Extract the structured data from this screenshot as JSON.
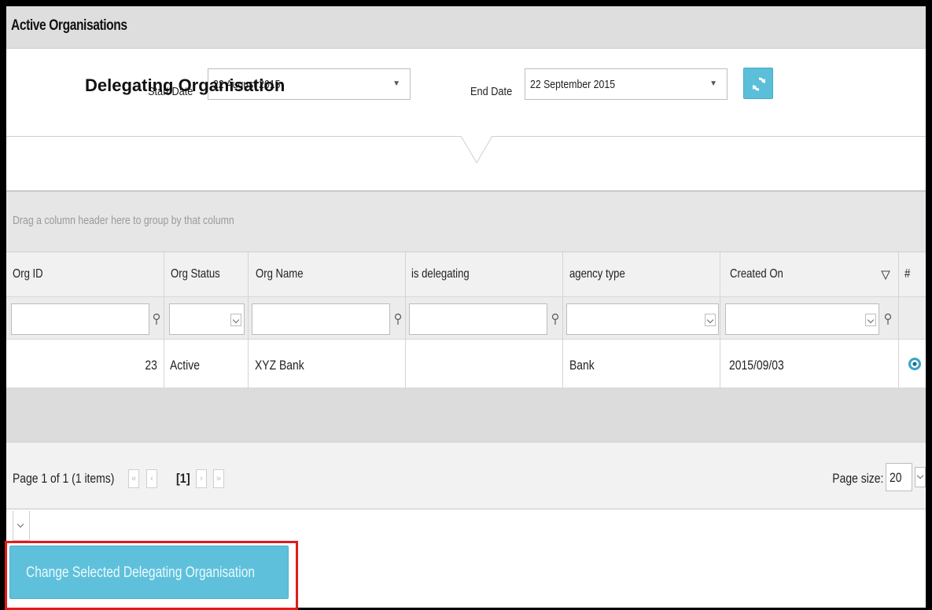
{
  "panel": {
    "title": "Active Organisations"
  },
  "overlay_title": "Delegating Organisation",
  "filters": {
    "start_date_label": "Start Date",
    "start_date_value": "22 August 2015",
    "end_date_label": "End Date",
    "end_date_value": "22 September 2015",
    "refresh_icon": "refresh-icon"
  },
  "grid": {
    "group_hint": "Drag a column header here to group by that column",
    "columns": [
      "Org ID",
      "Org Status",
      "Org Name",
      "is delegating",
      "agency type",
      "Created On",
      "#"
    ],
    "rows": [
      {
        "org_id": "23",
        "org_status": "Active",
        "org_name": "XYZ Bank",
        "is_delegating": "",
        "agency_type": "Bank",
        "created_on": "2015/09/03"
      }
    ]
  },
  "pager": {
    "summary": "Page 1 of 1 (1 items)",
    "current_page": "[1]",
    "page_size_label": "Page size:",
    "page_size_value": "20"
  },
  "actions": {
    "change_button_label": "Change Selected Delegating Organisation"
  },
  "colors": {
    "accent": "#5fc0db",
    "highlight": "#e01b1b"
  }
}
